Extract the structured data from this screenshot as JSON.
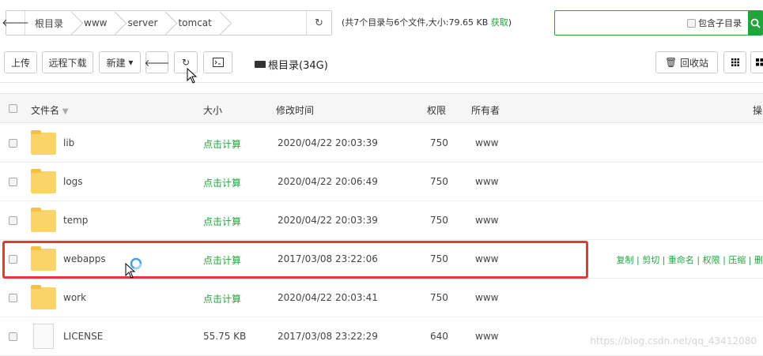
{
  "breadcrumb": {
    "back_icon": "arrow-left-icon",
    "items": [
      "根目录",
      "www",
      "server",
      "tomcat"
    ],
    "refresh_icon": "refresh-icon"
  },
  "summary": {
    "text": "(共7个目录与6个文件,大小:79.65 KB ",
    "link": "获取",
    "close": ")"
  },
  "search": {
    "value": "",
    "subdir_label": "包含子目录",
    "button_icon": "search-icon"
  },
  "toolbar": {
    "upload": "上传",
    "remote_download": "远程下载",
    "new": "新建",
    "new_caret": "▾",
    "back_icon": "arrow-left-icon",
    "refresh_icon": "refresh-icon",
    "terminal_icon": "terminal-icon",
    "disk_label": "根目录(34G)",
    "recycle": "回收站",
    "grid_icon": "grid-view-icon",
    "list_icon": "list-view-icon"
  },
  "table": {
    "headers": {
      "name": "文件名",
      "size": "大小",
      "mtime": "修改时间",
      "perm": "权限",
      "owner": "所有者",
      "ops": "操"
    },
    "rows": [
      {
        "type": "folder",
        "name": "lib",
        "size": "点击计算",
        "mtime": "2020/04/22 20:03:39",
        "perm": "750",
        "owner": "www"
      },
      {
        "type": "folder",
        "name": "logs",
        "size": "点击计算",
        "mtime": "2020/04/22 20:06:49",
        "perm": "750",
        "owner": "www"
      },
      {
        "type": "folder",
        "name": "temp",
        "size": "点击计算",
        "mtime": "2020/04/22 20:03:39",
        "perm": "750",
        "owner": "www"
      },
      {
        "type": "folder",
        "name": "webapps",
        "size": "点击计算",
        "mtime": "2017/03/08 23:22:06",
        "perm": "750",
        "owner": "www",
        "ops": "复制 | 剪切 | 重命名 | 权限 | 压缩 | 删"
      },
      {
        "type": "folder",
        "name": "work",
        "size": "点击计算",
        "mtime": "2020/04/22 20:03:41",
        "perm": "750",
        "owner": "www"
      },
      {
        "type": "file",
        "name": "LICENSE",
        "size": "55.75 KB",
        "mtime": "2017/03/08 23:22:29",
        "perm": "640",
        "owner": "www"
      }
    ]
  },
  "watermark": "https://blog.csdn.net/qq_43412080",
  "colors": {
    "accent": "#20a53a",
    "highlight": "#e53935",
    "folder": "#fbd469"
  }
}
